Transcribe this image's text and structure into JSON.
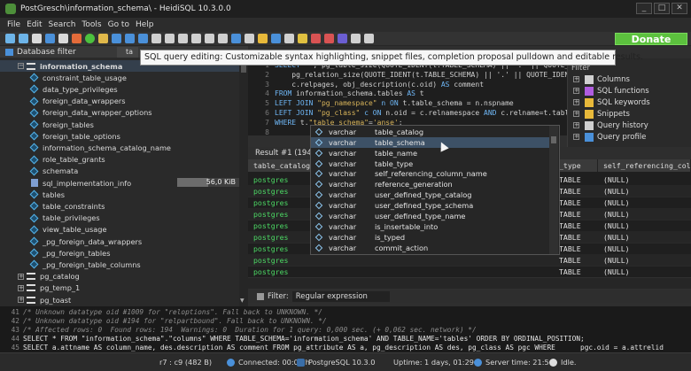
{
  "window": {
    "title": "PostGresch\\information_schema\\ - HeidiSQL 10.3.0.0",
    "controls": [
      "_",
      "□",
      "✕"
    ]
  },
  "menu": [
    "File",
    "Edit",
    "Search",
    "Tools",
    "Go to",
    "Help"
  ],
  "toolbar": {
    "donate_label": "Donate",
    "icon_colors": [
      "#6db4e8",
      "#6db4e8",
      "#d9d9d9",
      "#4a90d9",
      "#d9d9d9",
      "#e36b3a",
      "#4cc13e",
      "#e0b84a",
      "#4a90d9",
      "#4a90d9",
      "#4a90d9",
      "#d0d0d0",
      "#d0d0d0",
      "#d0d0d0",
      "#d0d0d0",
      "#d0d0d0",
      "#d0d0d0",
      "#4a90d9",
      "#d0d0d0",
      "#e8b93a",
      "#4a90d9",
      "#d0d0d0",
      "#e0c040",
      "#d95353",
      "#d95353",
      "#6b5ed2",
      "#d0d0d0",
      "#d0d0d0"
    ]
  },
  "left": {
    "filter_label": "Database filter",
    "tab_stub": "ta",
    "tree": [
      {
        "type": "schema",
        "label": "information_schema",
        "selected": true
      },
      {
        "type": "view",
        "label": "constraint_table_usage"
      },
      {
        "type": "view",
        "label": "data_type_privileges"
      },
      {
        "type": "view",
        "label": "foreign_data_wrappers"
      },
      {
        "type": "view",
        "label": "foreign_data_wrapper_options"
      },
      {
        "type": "view",
        "label": "foreign_tables"
      },
      {
        "type": "view",
        "label": "foreign_table_options"
      },
      {
        "type": "view",
        "label": "information_schema_catalog_name"
      },
      {
        "type": "view",
        "label": "role_table_grants"
      },
      {
        "type": "view",
        "label": "schemata"
      },
      {
        "type": "table",
        "label": "sql_implementation_info",
        "size": "56,0 KiB"
      },
      {
        "type": "view",
        "label": "tables"
      },
      {
        "type": "view",
        "label": "table_constraints"
      },
      {
        "type": "view",
        "label": "table_privileges"
      },
      {
        "type": "view",
        "label": "view_table_usage"
      },
      {
        "type": "view",
        "label": "_pg_foreign_data_wrappers"
      },
      {
        "type": "view",
        "label": "_pg_foreign_tables"
      },
      {
        "type": "view",
        "label": "_pg_foreign_table_columns"
      },
      {
        "type": "db",
        "label": "pg_catalog"
      },
      {
        "type": "db",
        "label": "pg_temp_1"
      },
      {
        "type": "db",
        "label": "pg_toast"
      }
    ],
    "size_fill_fraction": 0.5
  },
  "tooltip": "SQL query editing: Customizable syntax highlighting, snippet files, completion proposal pulldown and editable results.",
  "editor": {
    "lines": [
      {
        "n": "1",
        "segments": [
          [
            "kw",
            "SELECT "
          ],
          [
            "fn",
            "* , pg_table_size(QUOTE_IDENT(t.TABLE_SCHEMA) || '.' || QUOTE_IDENT(t.TABLE_NAME))"
          ]
        ]
      },
      {
        "n": "2",
        "segments": [
          [
            "fn",
            "    pg_relation_size(QUOTE_IDENT(t.TABLE_SCHEMA) || '.' || QUOTE_IDENT(t"
          ]
        ]
      },
      {
        "n": "3",
        "segments": [
          [
            "fn",
            "    c.relpages, obj_description(c.oid) "
          ],
          [
            "kw",
            "AS"
          ],
          [
            "ident",
            " comment"
          ]
        ]
      },
      {
        "n": "4",
        "segments": [
          [
            "kw",
            "FROM "
          ],
          [
            "ident",
            "information_schema.tables "
          ],
          [
            "kw",
            "AS"
          ],
          [
            "ident",
            " t"
          ]
        ]
      },
      {
        "n": "5",
        "segments": [
          [
            "kw",
            "LEFT JOIN "
          ],
          [
            "str",
            "\"pg_namespace\""
          ],
          [
            "kw",
            " n ON "
          ],
          [
            "ident",
            "t.table_schema = n.nspname"
          ]
        ]
      },
      {
        "n": "6",
        "segments": [
          [
            "kw",
            "LEFT JOIN "
          ],
          [
            "str",
            "\"pg_class\""
          ],
          [
            "kw",
            " c ON "
          ],
          [
            "ident",
            "n.oid = c.relnamespace "
          ],
          [
            "kw",
            "AND"
          ],
          [
            "ident",
            " c.relname=t.table_"
          ]
        ]
      },
      {
        "n": "7",
        "segments": [
          [
            "kw",
            "WHERE "
          ],
          [
            "ident",
            "t."
          ],
          [
            "str",
            "\"table_schema\""
          ],
          [
            "ident",
            "="
          ],
          [
            "str",
            "'anse'"
          ],
          [
            "ident",
            ";"
          ]
        ]
      },
      {
        "n": "8",
        "segments": []
      }
    ]
  },
  "right": {
    "filter_stub": "Filter",
    "items": [
      {
        "label": "Columns",
        "icon": "columns-icon",
        "color": "#d0d0d0"
      },
      {
        "label": "SQL functions",
        "icon": "sql-functions-icon",
        "color": "#b05ce0"
      },
      {
        "label": "SQL keywords",
        "icon": "sql-keywords-icon",
        "color": "#e8b93a"
      },
      {
        "label": "Snippets",
        "icon": "snippets-icon",
        "color": "#e8b93a"
      },
      {
        "label": "Query history",
        "icon": "query-history-icon",
        "color": "#d0d0d0"
      },
      {
        "label": "Query profile",
        "icon": "query-profile-icon",
        "color": "#4a90d9"
      }
    ]
  },
  "results": {
    "tab_label": "Result #1 (194 r",
    "headers": [
      "table_catalog",
      "_type",
      "self_referencing_colu"
    ],
    "rows": [
      [
        "postgres",
        "TABLE",
        "(NULL)"
      ],
      [
        "postgres",
        "TABLE",
        "(NULL)"
      ],
      [
        "postgres",
        "TABLE",
        "(NULL)"
      ],
      [
        "postgres",
        "TABLE",
        "(NULL)"
      ],
      [
        "postgres",
        "TABLE",
        "(NULL)"
      ],
      [
        "postgres",
        "TABLE",
        "(NULL)"
      ],
      [
        "postgres",
        "TABLE",
        "(NULL)"
      ],
      [
        "postgres",
        "TABLE",
        "(NULL)"
      ],
      [
        "postgres",
        "TABLE",
        "(NULL)"
      ]
    ]
  },
  "completion": {
    "items": [
      {
        "type": "varchar",
        "name": "table_catalog"
      },
      {
        "type": "varchar",
        "name": "table_schema",
        "selected": true
      },
      {
        "type": "varchar",
        "name": "table_name"
      },
      {
        "type": "varchar",
        "name": "table_type"
      },
      {
        "type": "varchar",
        "name": "self_referencing_column_name"
      },
      {
        "type": "varchar",
        "name": "reference_generation"
      },
      {
        "type": "varchar",
        "name": "user_defined_type_catalog"
      },
      {
        "type": "varchar",
        "name": "user_defined_type_schema"
      },
      {
        "type": "varchar",
        "name": "user_defined_type_name"
      },
      {
        "type": "varchar",
        "name": "is_insertable_into"
      },
      {
        "type": "varchar",
        "name": "is_typed"
      },
      {
        "type": "varchar",
        "name": "commit_action"
      }
    ]
  },
  "filterbar": {
    "label": "Filter:",
    "value": "Regular expression"
  },
  "log": [
    {
      "n": "41",
      "kind": "comment",
      "text": "/* Unknown datatype oid #1009 for \"reloptions\". Fall back to UNKNOWN. */"
    },
    {
      "n": "42",
      "kind": "comment",
      "text": "/* Unknown datatype oid #194 for \"relpartbound\". Fall back to UNKNOWN. */"
    },
    {
      "n": "43",
      "kind": "comment",
      "text": "/* Affected rows: 0  Found rows: 194  Warnings: 0  Duration for 1 query: 0,000 sec. (+ 0,062 sec. network) */"
    },
    {
      "n": "44",
      "kind": "sql",
      "text": "SELECT * FROM \"information_schema\".\"columns\" WHERE TABLE_SCHEMA='information_schema' AND TABLE_NAME='tables' ORDER BY ORDINAL_POSITION;"
    },
    {
      "n": "45",
      "kind": "sql",
      "text": "SELECT a.attname AS column_name, des.description AS comment FROM pg_attribute AS a, pg_description AS des, pg_class AS pgc WHERE      pgc.oid = a.attrelid       AND des."
    }
  ],
  "status": {
    "position": "r7 : c9 (482 B)",
    "connected": "Connected: 00:01 h",
    "server": "PostgreSQL 10.3.0",
    "uptime": "Uptime: 1 days, 01:29 h",
    "server_time": "Server time: 21:56",
    "state": "Idle."
  }
}
